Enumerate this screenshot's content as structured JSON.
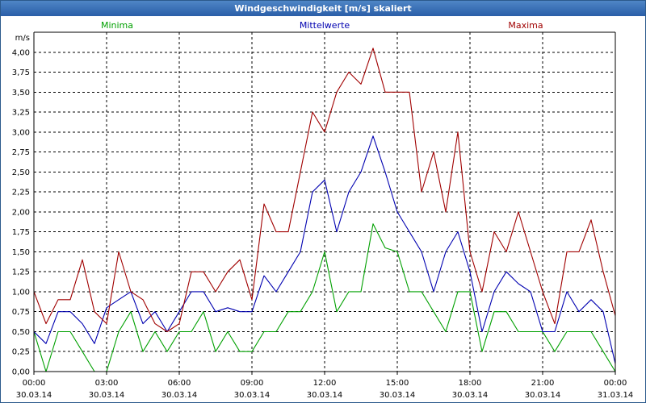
{
  "window": {
    "title": "Windgeschwindigkeit [m/s] skaliert"
  },
  "chart_data": {
    "type": "line",
    "title": "Windgeschwindigkeit [m/s] skaliert",
    "ylabel": "m/s",
    "xlabel": "",
    "ylim": [
      0,
      4.25
    ],
    "xlim": [
      0,
      24
    ],
    "grid": true,
    "legend_position": "top",
    "y_ticks": [
      "0,00",
      "0,25",
      "0,50",
      "0,75",
      "1,00",
      "1,25",
      "1,50",
      "1,75",
      "2,00",
      "2,25",
      "2,50",
      "2,75",
      "3,00",
      "3,25",
      "3,50",
      "3,75",
      "4,00"
    ],
    "x_ticks": [
      {
        "time": "00:00",
        "date": "30.03.14"
      },
      {
        "time": "03:00",
        "date": "30.03.14"
      },
      {
        "time": "06:00",
        "date": "30.03.14"
      },
      {
        "time": "09:00",
        "date": "30.03.14"
      },
      {
        "time": "12:00",
        "date": "30.03.14"
      },
      {
        "time": "15:00",
        "date": "30.03.14"
      },
      {
        "time": "18:00",
        "date": "30.03.14"
      },
      {
        "time": "21:00",
        "date": "30.03.14"
      },
      {
        "time": "00:00",
        "date": "31.03.14"
      }
    ],
    "x_hours": [
      0,
      0.5,
      1,
      1.5,
      2,
      2.5,
      3,
      3.5,
      4,
      4.5,
      5,
      5.5,
      6,
      6.5,
      7,
      7.5,
      8,
      8.5,
      9,
      9.5,
      10,
      10.5,
      11,
      11.5,
      12,
      12.5,
      13,
      13.5,
      14,
      14.5,
      15,
      15.5,
      16,
      16.5,
      17,
      17.5,
      18,
      18.5,
      19,
      19.5,
      20,
      20.5,
      21,
      21.5,
      22,
      22.5,
      23,
      23.5,
      24
    ],
    "series": [
      {
        "name": "Minima",
        "color": "#00a000",
        "values": [
          0.5,
          0,
          0.5,
          0.5,
          0.25,
          0,
          0,
          0.5,
          0.75,
          0.25,
          0.5,
          0.25,
          0.5,
          0.5,
          0.75,
          0.25,
          0.5,
          0.25,
          0.25,
          0.5,
          0.5,
          0.75,
          0.75,
          1.0,
          1.5,
          0.75,
          1.0,
          1.0,
          1.85,
          1.55,
          1.5,
          1.0,
          1.0,
          0.75,
          0.5,
          1.0,
          1.0,
          0.25,
          0.75,
          0.75,
          0.5,
          0.5,
          0.5,
          0.25,
          0.5,
          0.5,
          0.5,
          0.25,
          0
        ]
      },
      {
        "name": "Mittelwerte",
        "color": "#0000b0",
        "values": [
          0.5,
          0.35,
          0.75,
          0.75,
          0.6,
          0.35,
          0.8,
          0.9,
          1.0,
          0.6,
          0.75,
          0.5,
          0.75,
          1.0,
          1.0,
          0.75,
          0.8,
          0.75,
          0.75,
          1.2,
          1.0,
          1.25,
          1.5,
          2.25,
          2.4,
          1.75,
          2.25,
          2.5,
          2.95,
          2.5,
          2.0,
          1.75,
          1.5,
          1.0,
          1.5,
          1.75,
          1.25,
          0.5,
          1.0,
          1.25,
          1.1,
          1.0,
          0.5,
          0.5,
          1.0,
          0.75,
          0.9,
          0.75,
          0.1
        ]
      },
      {
        "name": "Maxima",
        "color": "#a00000",
        "values": [
          1.0,
          0.6,
          0.9,
          0.9,
          1.4,
          0.75,
          0.6,
          1.5,
          1.0,
          0.9,
          0.6,
          0.5,
          0.6,
          1.25,
          1.25,
          1.0,
          1.25,
          1.4,
          0.9,
          2.1,
          1.75,
          1.75,
          2.5,
          3.25,
          3.0,
          3.5,
          3.75,
          3.6,
          4.05,
          3.5,
          3.5,
          3.5,
          2.25,
          2.75,
          2.0,
          3.0,
          1.5,
          1.0,
          1.75,
          1.5,
          2.0,
          1.5,
          1.0,
          0.6,
          1.5,
          1.5,
          1.9,
          1.25,
          0.7
        ]
      }
    ]
  }
}
